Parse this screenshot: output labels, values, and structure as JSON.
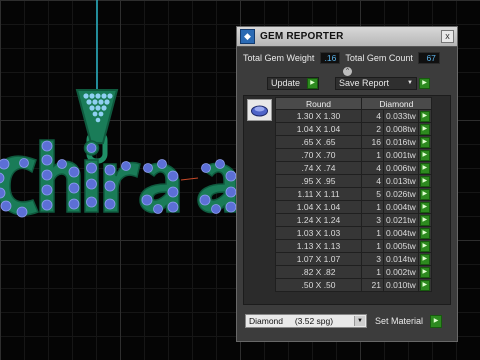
{
  "panel": {
    "title": "GEM REPORTER",
    "close_glyph": "x",
    "total_weight_label": "Total Gem Weight",
    "total_weight_value": ".16",
    "total_count_label": "Total Gem Count",
    "total_count_value": "67",
    "collapse_glyph": "^",
    "update_label": "Update",
    "save_report_label": "Save Report",
    "save_report_arrow": "▼",
    "go_glyph": "▶"
  },
  "table": {
    "col_round": "Round",
    "col_diamond": "Diamond",
    "rows": [
      {
        "size": "1.30 X 1.30",
        "count": "4",
        "weight": "0.033tw"
      },
      {
        "size": "1.04 X 1.04",
        "count": "2",
        "weight": "0.008tw"
      },
      {
        "size": ".65 X .65",
        "count": "16",
        "weight": "0.016tw"
      },
      {
        "size": ".70 X .70",
        "count": "1",
        "weight": "0.001tw"
      },
      {
        "size": ".74 X .74",
        "count": "4",
        "weight": "0.006tw"
      },
      {
        "size": ".95 X .95",
        "count": "4",
        "weight": "0.013tw"
      },
      {
        "size": "1.11 X 1.11",
        "count": "5",
        "weight": "0.026tw"
      },
      {
        "size": "1.04 X 1.04",
        "count": "1",
        "weight": "0.004tw"
      },
      {
        "size": "1.24 X 1.24",
        "count": "3",
        "weight": "0.021tw"
      },
      {
        "size": "1.03 X 1.03",
        "count": "1",
        "weight": "0.004tw"
      },
      {
        "size": "1.13 X 1.13",
        "count": "1",
        "weight": "0.005tw"
      },
      {
        "size": "1.07 X 1.07",
        "count": "3",
        "weight": "0.014tw"
      },
      {
        "size": ".82 X .82",
        "count": "1",
        "weight": "0.002tw"
      },
      {
        "size": ".50 X .50",
        "count": "21",
        "weight": "0.010tw"
      }
    ]
  },
  "material": {
    "selected": "Diamond     (3.52 spg)",
    "set_material_label": "Set Material"
  },
  "viewport": {
    "pendant_text": "Chiara",
    "colors": {
      "metal": "#1f8f66",
      "metal_dark": "#0f5a3e",
      "stone": "#5c6fd6",
      "background": "#050505"
    }
  },
  "icons": {
    "app": "gem-reporter-icon",
    "close": "close-icon",
    "go": "play-arrow-icon",
    "dropdown": "chevron-down-icon",
    "thumb": "round-gem-icon"
  }
}
